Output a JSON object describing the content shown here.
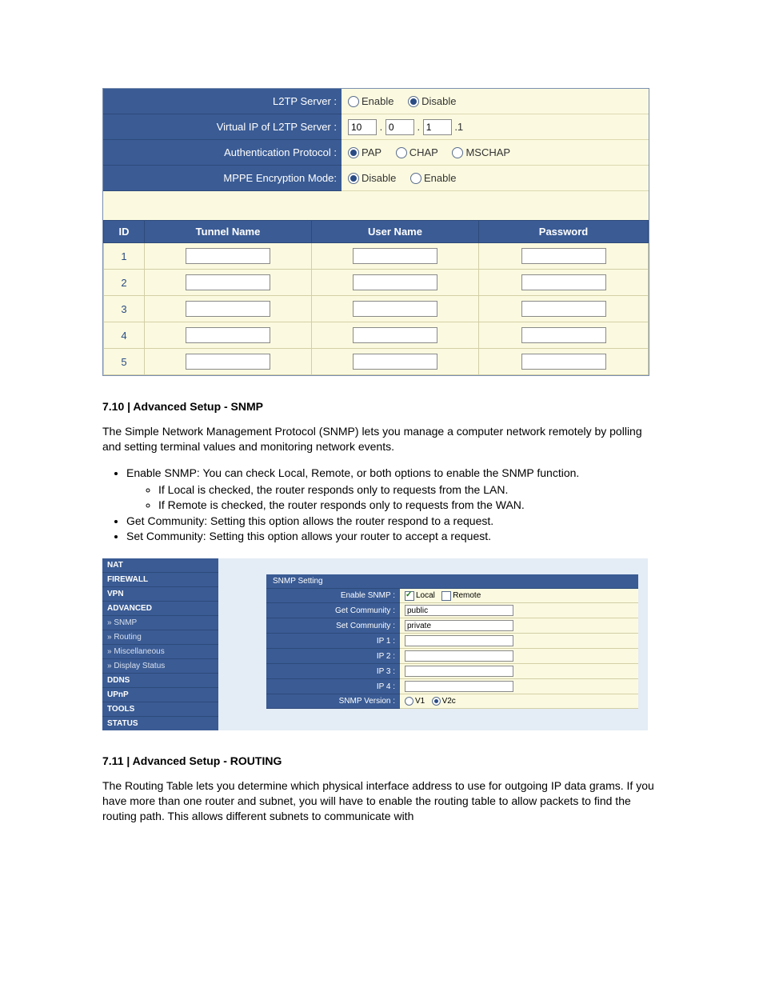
{
  "l2tp": {
    "rows": {
      "server": {
        "label": "L2TP Server :",
        "opt1": "Enable",
        "opt2": "Disable",
        "selected": 2
      },
      "vip": {
        "label": "Virtual IP of L2TP Server :",
        "o1": "10",
        "o2": "0",
        "o3": "1",
        "suffix": ".1"
      },
      "auth": {
        "label": "Authentication Protocol :",
        "opt1": "PAP",
        "opt2": "CHAP",
        "opt3": "MSCHAP",
        "selected": 1
      },
      "mppe": {
        "label": "MPPE Encryption Mode:",
        "opt1": "Disable",
        "opt2": "Enable",
        "selected": 1
      }
    },
    "tunnel": {
      "headers": {
        "id": "ID",
        "name": "Tunnel Name",
        "user": "User Name",
        "pass": "Password"
      },
      "rows": [
        "1",
        "2",
        "3",
        "4",
        "5"
      ]
    }
  },
  "section_snmp": {
    "heading": "7.10 | Advanced Setup - SNMP",
    "intro": "The Simple Network Management Protocol (SNMP) lets you manage a computer network remotely by polling and setting terminal values and monitoring network events.",
    "b1": "Enable SNMP: You can check Local, Remote, or both options to enable the SNMP function.",
    "b1a": "If Local is checked, the router responds only to requests from the LAN.",
    "b1b": "If Remote is checked, the router responds only to requests from the WAN.",
    "b2": "Get Community: Setting this option allows the router respond to a request.",
    "b3": "Set Community: Setting this option allows your router to accept a request."
  },
  "snmp_shot": {
    "sidebar": {
      "nat": "NAT",
      "firewall": "FIREWALL",
      "vpn": "VPN",
      "advanced": "ADVANCED",
      "snmp": "» SNMP",
      "routing": "» Routing",
      "misc": "» Miscellaneous",
      "disp": "» Display Status",
      "ddns": "DDNS",
      "upnp": "UPnP",
      "tools": "TOOLS",
      "status": "STATUS"
    },
    "title": "SNMP Setting",
    "rows": {
      "enable": {
        "label": "Enable SNMP :",
        "local": "Local",
        "remote": "Remote"
      },
      "get": {
        "label": "Get Community :",
        "value": "public"
      },
      "set": {
        "label": "Set Community :",
        "value": "private"
      },
      "ip1": {
        "label": "IP 1 :",
        "value": ""
      },
      "ip2": {
        "label": "IP 2 :",
        "value": ""
      },
      "ip3": {
        "label": "IP 3 :",
        "value": ""
      },
      "ip4": {
        "label": "IP 4 :",
        "value": ""
      },
      "ver": {
        "label": "SNMP Version :",
        "v1": "V1",
        "v2": "V2c"
      }
    }
  },
  "section_routing": {
    "heading": "7.11 | Advanced Setup - ROUTING",
    "intro": "The Routing Table lets you determine which physical interface address to use for outgoing IP data grams. If you have more than one router and subnet, you will have to enable the routing table to allow packets to find the routing path. This allows different subnets to communicate with"
  }
}
